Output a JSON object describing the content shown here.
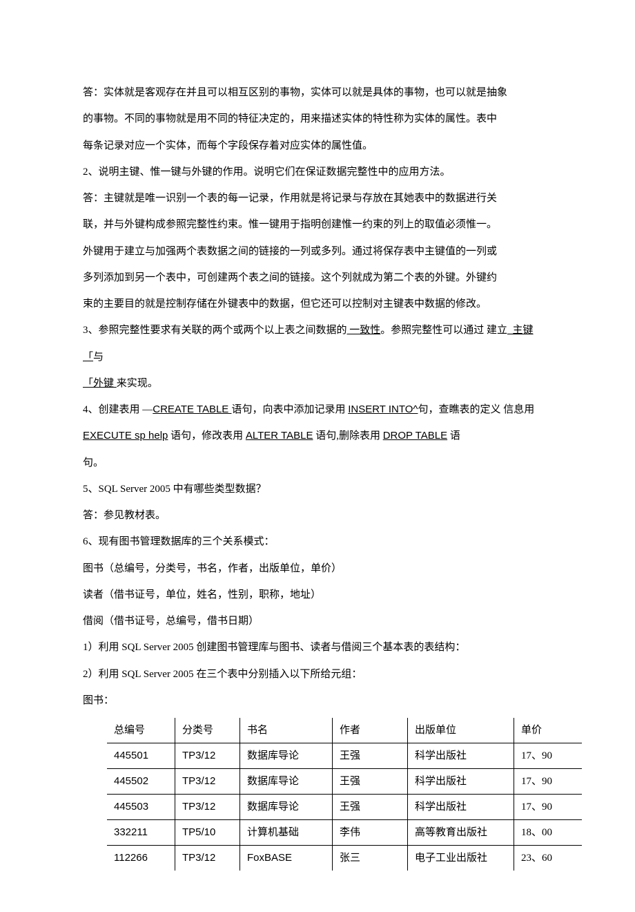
{
  "p1a": "答：实体就是客观存在并且可以相互区别的事物，实体可以就是具体的事物，也可以就是抽象",
  "p1b": "的事物。不同的事物就是用不同的特征决定的，用来描述实体的特性称为实体的属性。表中",
  "p1c": "每条记录对应一个实体，而每个字段保存着对应实体的属性值。",
  "p2": "2、说明主键、惟一键与外键的作用。说明它们在保证数据完整性中的应用方法。",
  "p3a": "答：主键就是唯一识别一个表的每一记录，作用就是将记录与存放在其她表中的数据进行关",
  "p3b": "联，并与外键构成参照完整性约束。惟一键用于指明创建惟一约束的列上的取值必须惟一。",
  "p3c": "外键用于建立与加强两个表数据之间的链接的一列或多列。通过将保存表中主键值的一列或",
  "p3d": "多列添加到另一个表中，可创建两个表之间的链接。这个列就成为第二个表的外键。外键约",
  "p3e": "束的主要目的就是控制存储在外键表中的数据，但它还可以控制对主键表中数据的修改。",
  "p4": {
    "t1": "3、参照完整性要求有关联的两个或两个以上表之间数据的",
    "u1": " 一致性",
    "t2": "。参照完整性可以通过 建立",
    "u2": "_主键「",
    "t3": "与"
  },
  "p4b": {
    "u1": "「外键 ",
    "t1": "来实现。"
  },
  "p5": {
    "t1": "4、创建表用 —",
    "u1": "CREATE TABLE ",
    "t2": " 语句，向表中添加记录用 ",
    "u2": "  INSERT INTO^",
    "t3": "句，查瞧表的定义 信息用"
  },
  "p5b": {
    "u1": "EXECUTE sp help",
    "t1": " 语句，修改表用 ",
    "u2": " ALTER TABLE",
    "t2": " 语句,删除表用 ",
    "u3": " DROP TABLE",
    "t3": " 语"
  },
  "p5c": "句。",
  "p6": "5、SQL Server 2005 中有哪些类型数据？",
  "p7": "答：参见教材表。",
  "p8": "6、现有图书管理数据库的三个关系模式：",
  "p9": "图书（总编号，分类号，书名，作者，出版单位，单价）",
  "p10": "读者（借书证号，单位，姓名，性别，职称，地址）",
  "p11": "借阅（借书证号，总编号，借书日期）",
  "p12": "  1）利用 SQL Server 2005 创建图书管理库与图书、读者与借阅三个基本表的表结构：",
  "p13": "  2）利用 SQL Server 2005 在三个表中分别插入以下所给元组：",
  "p14": "图书：",
  "table": {
    "headers": [
      "总编号",
      "分类号",
      "书名",
      "作者",
      "出版单位",
      "单价"
    ],
    "rows": [
      [
        "445501",
        "TP3/12",
        "数据库导论",
        "王强",
        "科学出版社",
        "17、90"
      ],
      [
        "445502",
        "TP3/12",
        "数据库导论",
        "王强",
        "科学出版社",
        "17、90"
      ],
      [
        "445503",
        "TP3/12",
        "数据库导论",
        "王强",
        "科学出版社",
        "17、90"
      ],
      [
        "332211",
        "TP5/10",
        "计算机基础",
        "李伟",
        "高等教育出版社",
        "18、00"
      ],
      [
        "112266",
        "TP3/12",
        "FoxBASE",
        "张三",
        "电子工业出版社",
        "23、60"
      ]
    ]
  }
}
